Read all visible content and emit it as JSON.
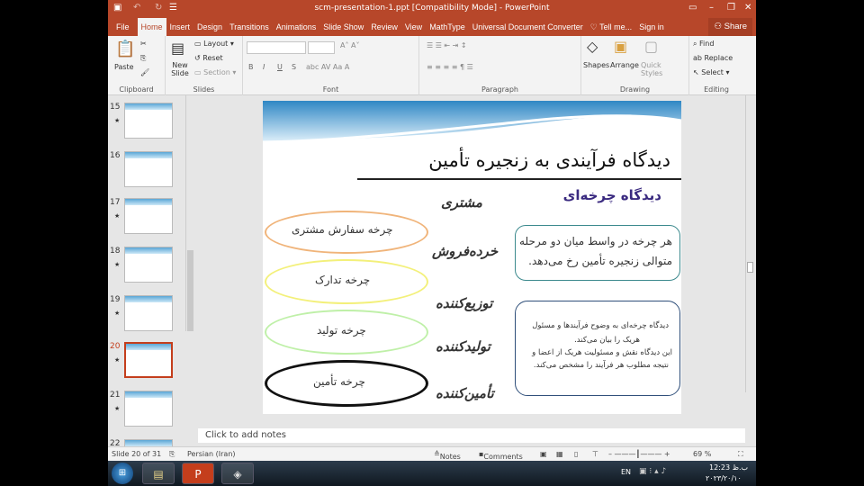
{
  "window": {
    "title": "scm-presentation-1.ppt [Compatibility Mode] - PowerPoint"
  },
  "tabs": [
    "File",
    "Home",
    "Insert",
    "Design",
    "Transitions",
    "Animations",
    "Slide Show",
    "Review",
    "View",
    "MathType",
    "Universal Document Converter"
  ],
  "tell_me": "Tell me...",
  "sign_in": "Sign in",
  "share": "Share",
  "ribbon": {
    "clipboard": {
      "label": "Clipboard",
      "paste": "Paste"
    },
    "slides": {
      "label": "Slides",
      "new_slide": "New Slide",
      "layout": "Layout",
      "reset": "Reset",
      "section": "Section"
    },
    "font": {
      "label": "Font",
      "bold": "B",
      "italic": "I",
      "underline": "U",
      "strike": "S"
    },
    "paragraph": {
      "label": "Paragraph"
    },
    "drawing": {
      "label": "Drawing",
      "shapes": "Shapes",
      "arrange": "Arrange",
      "quick_styles": "Quick Styles"
    },
    "editing": {
      "label": "Editing",
      "find": "Find",
      "replace": "Replace",
      "select": "Select"
    }
  },
  "thumbnails": [
    {
      "num": "15",
      "star": "★"
    },
    {
      "num": "16",
      "star": ""
    },
    {
      "num": "17",
      "star": "★"
    },
    {
      "num": "18",
      "star": "★"
    },
    {
      "num": "19",
      "star": "★"
    },
    {
      "num": "20",
      "star": "★"
    },
    {
      "num": "21",
      "star": "★"
    },
    {
      "num": "22",
      "star": ""
    }
  ],
  "slide": {
    "title": "دیدگاه فرآیندی به زنجیره تأمین",
    "subtitle": "دیدگاه چرخه‌ای",
    "roles": [
      "مشتری",
      "خرده‌فروش",
      "توزیع‌کننده",
      "تولیدکننده",
      "تأمین‌کننده"
    ],
    "cycles": [
      "چرخه سفارش مشتری",
      "چرخه تدارک",
      "چرخه تولید",
      "چرخه تأمین"
    ],
    "callout1": [
      "هر چرخه در واسط میان دو مرحله",
      "متوالی زنجیره تأمین رخ می‌دهد."
    ],
    "callout2": [
      "دیدگاه چرخه‌ای به وضوح فرآیندها و مسئول",
      "هریک را بیان می‌کند.",
      "این دیدگاه نقش و مسئولیت هریک از اعضا و",
      "نتیجه مطلوب هر فرآیند را مشخص می‌کند."
    ]
  },
  "notes_placeholder": "Click to add notes",
  "status": {
    "slide": "Slide 20 of 31",
    "language": "Persian (Iran)",
    "notes": "Notes",
    "comments": "Comments",
    "zoom": "69 %"
  },
  "taskbar": {
    "lang": "EN",
    "time": "12:23 ب.ظ",
    "date": "۲۰۲۳/۲۰/۱۰"
  },
  "colors": {
    "accent": "#b7472a"
  }
}
